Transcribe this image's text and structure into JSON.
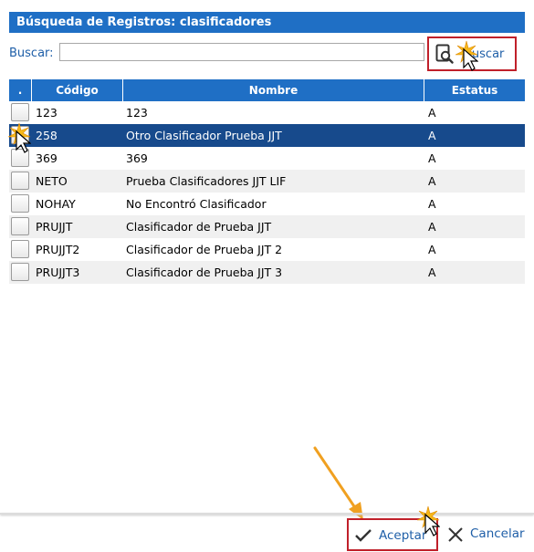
{
  "dialog": {
    "title": "Búsqueda de Registros: clasificadores"
  },
  "search": {
    "label": "Buscar:",
    "value": "",
    "placeholder": "",
    "button_label": "Buscar"
  },
  "grid": {
    "columns": [
      ".",
      "Código",
      "Nombre",
      "Estatus"
    ],
    "rows": [
      {
        "codigo": "123",
        "nombre": "123",
        "estatus": "A",
        "selected": false
      },
      {
        "codigo": "258",
        "nombre": "Otro Clasificador Prueba JJT",
        "estatus": "A",
        "selected": true
      },
      {
        "codigo": "369",
        "nombre": "369",
        "estatus": "A",
        "selected": false
      },
      {
        "codigo": "NETO",
        "nombre": "Prueba Clasificadores JJT LIF",
        "estatus": "A",
        "selected": false
      },
      {
        "codigo": "NOHAY",
        "nombre": "No Encontró Clasificador",
        "estatus": "A",
        "selected": false
      },
      {
        "codigo": "PRUJJT",
        "nombre": "Clasificador de Prueba JJT",
        "estatus": "A",
        "selected": false
      },
      {
        "codigo": "PRUJJT2",
        "nombre": "Clasificador de Prueba JJT 2",
        "estatus": "A",
        "selected": false
      },
      {
        "codigo": "PRUJJT3",
        "nombre": "Clasificador de Prueba JJT 3",
        "estatus": "A",
        "selected": false
      }
    ]
  },
  "footer": {
    "accept_label": "Aceptar",
    "cancel_label": "Cancelar"
  },
  "colors": {
    "header_blue": "#1f6fc5",
    "selected_row": "#174a8c",
    "highlight_border": "#c0202a",
    "link_blue": "#1f5fa8",
    "arrow_orange": "#f0a020"
  },
  "icons": [
    "search-icon",
    "check-icon",
    "close-icon",
    "cursor-click-icon",
    "arrow-annotation-icon"
  ]
}
